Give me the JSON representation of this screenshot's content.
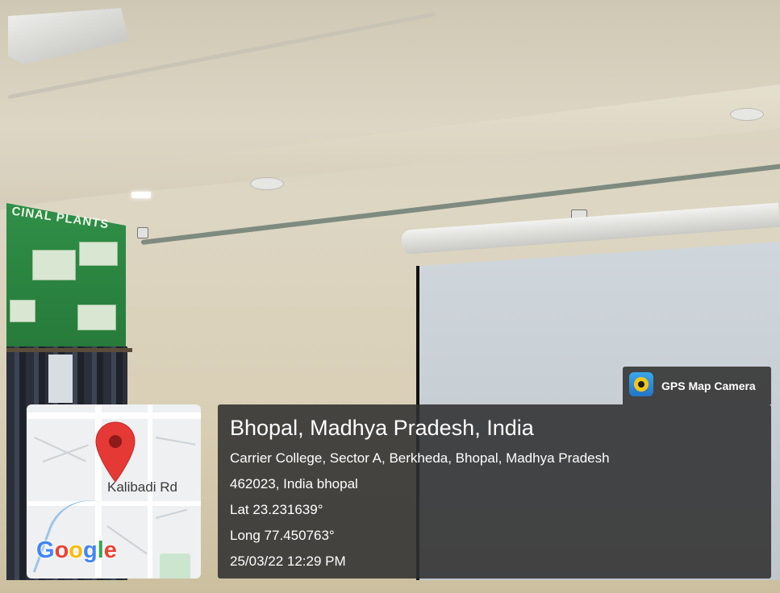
{
  "poster": {
    "title": "CINAL PLANTS"
  },
  "badge": {
    "label": "GPS Map Camera",
    "icon": "gps-map-camera-app-icon"
  },
  "map": {
    "road_label": "Kalibadi Rd",
    "brand": "Google",
    "brand_colors": [
      "#4285F4",
      "#EA4335",
      "#FBBC05",
      "#4285F4",
      "#34A853",
      "#EA4335"
    ],
    "pin_color": "#E53935"
  },
  "location": {
    "title": "Bhopal, Madhya Pradesh, India",
    "address_line1": "Carrier College, Sector A, Berkheda, Bhopal, Madhya Pradesh",
    "address_line2": "462023, India bhopal",
    "lat": "Lat 23.231639°",
    "long": "Long 77.450763°",
    "datetime": "25/03/22 12:29 PM"
  }
}
